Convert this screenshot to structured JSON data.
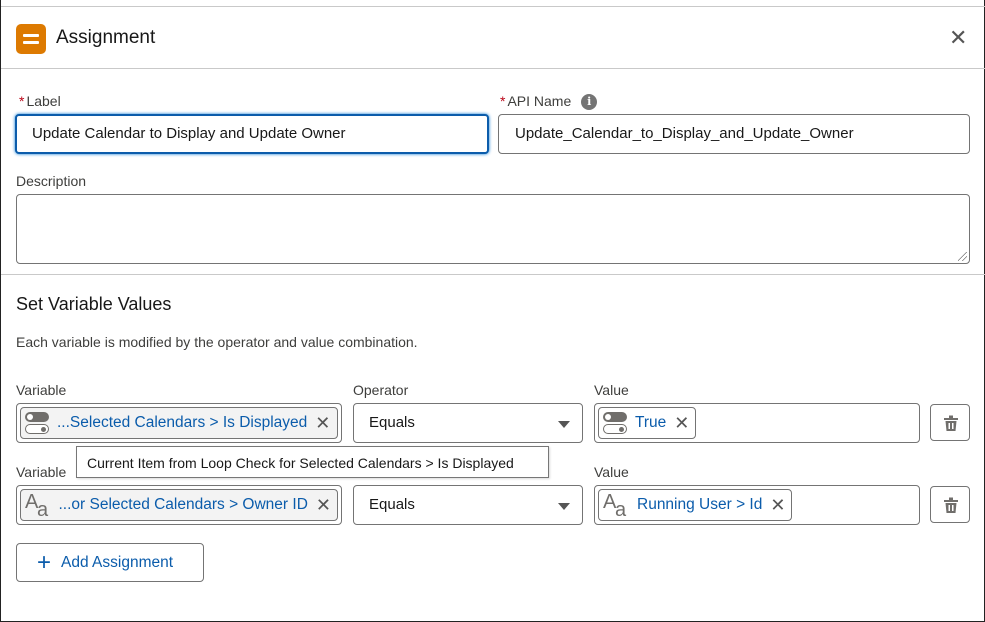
{
  "header": {
    "title": "Assignment",
    "icon": "assignment-icon",
    "close_icon": "close-icon",
    "close_glyph": "✕"
  },
  "form": {
    "label": {
      "label": "Label",
      "required": "*",
      "value": "Update Calendar to Display and Update Owner"
    },
    "api_name": {
      "label": "API Name",
      "required": "*",
      "value": "Update_Calendar_to_Display_and_Update_Owner",
      "info_glyph": "i"
    },
    "description": {
      "label": "Description",
      "value": ""
    }
  },
  "section": {
    "title": "Set Variable Values",
    "description": "Each variable is modified by the operator and value combination."
  },
  "rows": [
    {
      "variable_label": "Variable",
      "variable": "...Selected Calendars > Is Displayed",
      "variable_type_icon": "boolean-icon",
      "operator_label": "Operator",
      "operator": "Equals",
      "value_label": "Value",
      "value": "True",
      "value_type_icon": "boolean-icon"
    },
    {
      "variable_label": "Variable",
      "variable": "...or Selected Calendars > Owner ID",
      "variable_type_icon": "text-icon",
      "operator": "Equals",
      "value_label": "Value",
      "value": "Running User > Id",
      "value_type_icon": "text-icon"
    }
  ],
  "tooltip": "Current Item from Loop Check for Selected Calendars > Is Displayed",
  "add_button": {
    "label": "Add Assignment",
    "glyph": "+"
  },
  "glyphs": {
    "remove": "✕",
    "text_A": "A",
    "text_a": "a"
  }
}
